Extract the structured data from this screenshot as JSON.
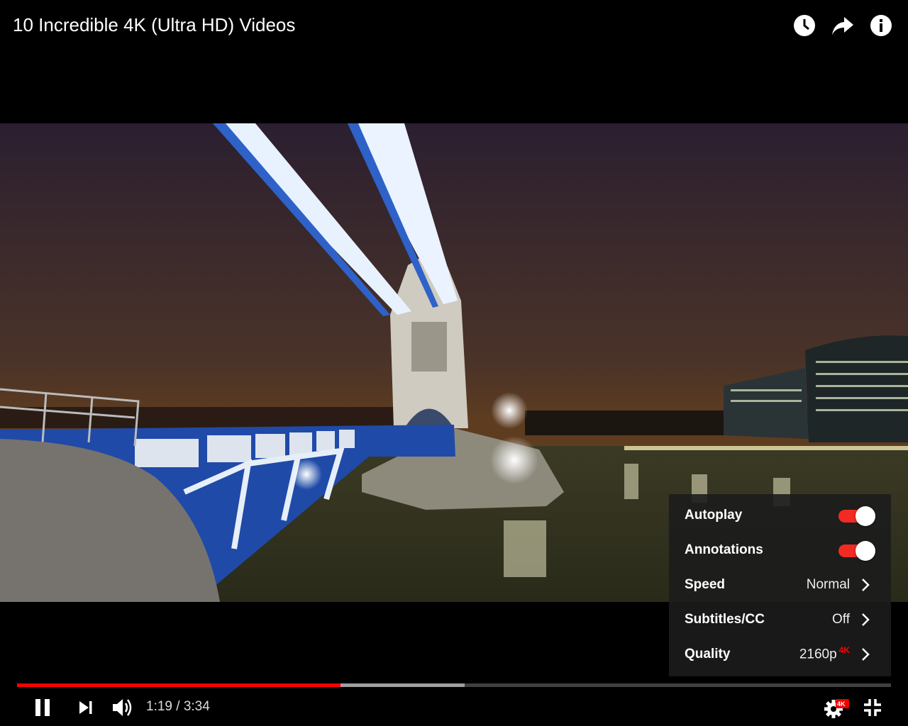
{
  "header": {
    "title": "10 Incredible 4K (Ultra HD) Videos",
    "icons": [
      "watch-later-icon",
      "share-icon",
      "info-icon"
    ]
  },
  "settings": {
    "items": [
      {
        "label": "Autoplay",
        "type": "toggle",
        "on": true
      },
      {
        "label": "Annotations",
        "type": "toggle",
        "on": true
      },
      {
        "label": "Speed",
        "value": "Normal"
      },
      {
        "label": "Subtitles/CC",
        "value": "Off"
      },
      {
        "label": "Quality",
        "value": "2160p",
        "badge": "4K"
      }
    ]
  },
  "progress": {
    "played_fraction": 0.37,
    "buffered_fraction": 0.512
  },
  "controls": {
    "time_current": "1:19",
    "time_separator": "/",
    "time_total": "3:34",
    "settings_badge": "4K"
  },
  "colors": {
    "accent": "#ff0000",
    "toggle_on": "#f12b24"
  }
}
